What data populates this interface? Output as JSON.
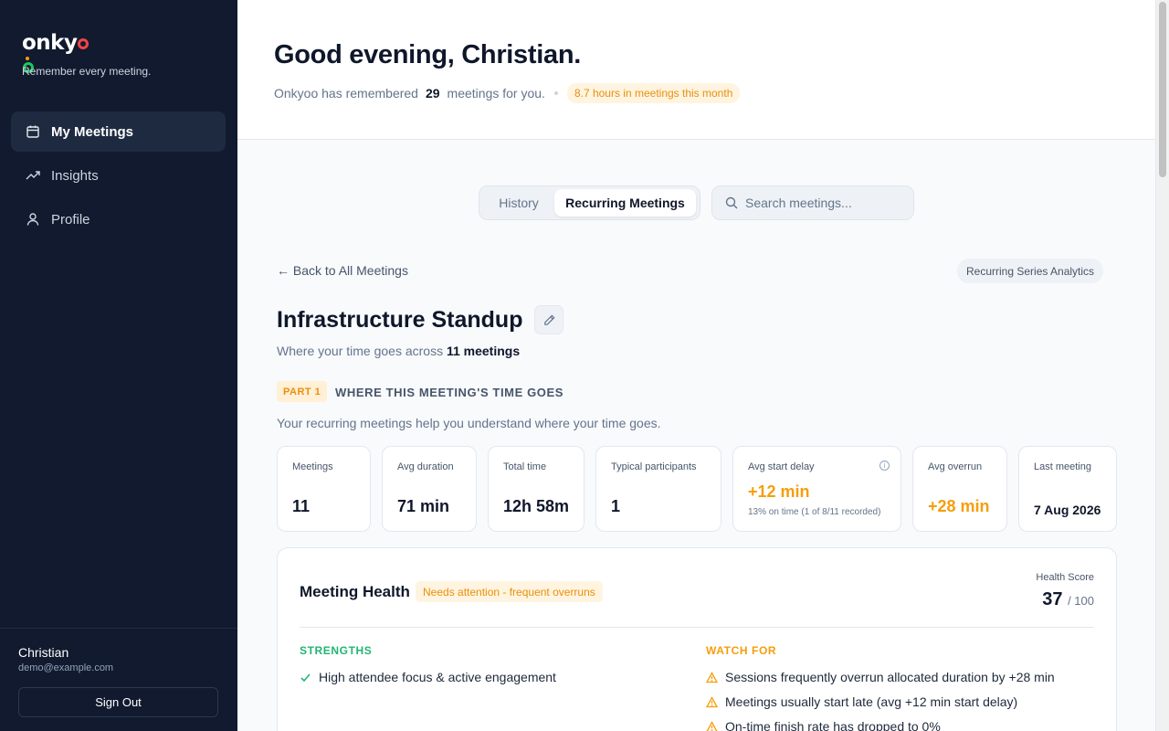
{
  "app": {
    "logo_text": "onkyoo",
    "tagline": "Remember every meeting."
  },
  "sidebar": {
    "items": [
      {
        "label": "My Meetings",
        "icon": "calendar-icon",
        "active": true
      },
      {
        "label": "Insights",
        "icon": "trending-up-icon",
        "active": false
      },
      {
        "label": "Profile",
        "icon": "user-icon",
        "active": false
      }
    ],
    "user": {
      "name": "Christian",
      "email": "demo@example.com",
      "signout_label": "Sign Out"
    }
  },
  "header": {
    "greeting": "Good evening, Christian.",
    "remembered_prefix": "Onkyoo has remembered",
    "meeting_count": "29",
    "remembered_suffix": "meetings for you.",
    "hours_pill": "8.7 hours in meetings this month"
  },
  "tabs": {
    "history": "History",
    "recurring": "Recurring Meetings",
    "active": "recurring"
  },
  "search": {
    "placeholder": "Search meetings...",
    "value": ""
  },
  "detail": {
    "back_label": "← Back to All Meetings",
    "analytics_label": "Recurring Series Analytics",
    "title": "Infrastructure Standup",
    "subtitle_prefix": "Where your time goes across",
    "subtitle_count": "11 meetings",
    "part_badge": "PART 1",
    "part_title": "WHERE THIS MEETING'S TIME GOES",
    "part_desc": "Your recurring meetings help you understand where your time goes."
  },
  "stats": [
    {
      "label": "Meetings",
      "value": "11"
    },
    {
      "label": "Avg duration",
      "value": "71 min"
    },
    {
      "label": "Total time",
      "value": "12h 58m"
    },
    {
      "label": "Typical participants",
      "value": "1"
    },
    {
      "label": "Avg start delay",
      "value": "+12 min",
      "note": "13% on time (1 of 8/11 recorded)",
      "info": "i"
    },
    {
      "label": "Avg overrun",
      "value": "+28 min"
    },
    {
      "label": "Last meeting",
      "value": "7 Aug 2026"
    }
  ],
  "health": {
    "title": "Meeting Health",
    "badge": "Needs attention - frequent overruns",
    "score_label": "Health Score",
    "score": "37",
    "score_max": "/ 100",
    "strengths_label": "STRENGTHS",
    "strengths": [
      "High attendee focus & active engagement"
    ],
    "watch_label": "WATCH FOR",
    "watch": [
      "Sessions frequently overrun allocated duration by +28 min",
      "Meetings usually start late (avg +12 min start delay)",
      "On-time finish rate has dropped to 0%"
    ]
  },
  "colors": {
    "sidebar_bg": "#111a2e",
    "accent_orange": "#f59e0b",
    "strength_green": "#22b573"
  }
}
